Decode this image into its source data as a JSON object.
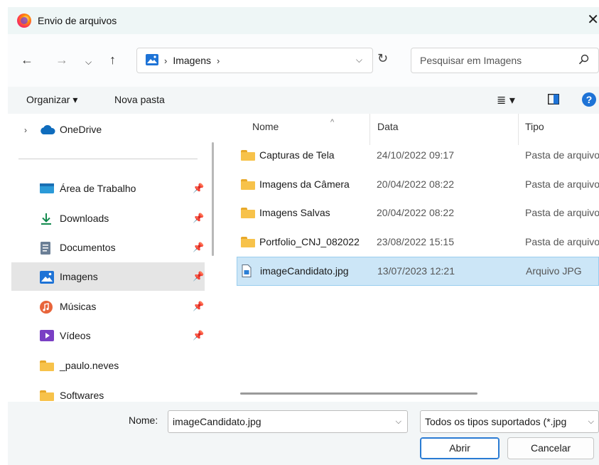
{
  "window": {
    "title": "Envio de arquivos",
    "close_label": "✕"
  },
  "nav": {
    "breadcrumb": [
      "Imagens"
    ],
    "search_placeholder": "Pesquisar em Imagens"
  },
  "toolbar": {
    "organize": "Organizar ▾",
    "new_folder": "Nova pasta"
  },
  "sidebar": {
    "onedrive": "OneDrive",
    "items": [
      {
        "label": "Área de Trabalho",
        "icon": "desktop-icon",
        "pinned": true
      },
      {
        "label": "Downloads",
        "icon": "download-icon",
        "pinned": true
      },
      {
        "label": "Documentos",
        "icon": "document-icon",
        "pinned": true
      },
      {
        "label": "Imagens",
        "icon": "pictures-icon",
        "pinned": true,
        "selected": true
      },
      {
        "label": "Músicas",
        "icon": "music-icon",
        "pinned": true
      },
      {
        "label": "Vídeos",
        "icon": "video-icon",
        "pinned": true
      },
      {
        "label": "_paulo.neves",
        "icon": "folder-icon",
        "pinned": false
      },
      {
        "label": "Softwares",
        "icon": "folder-icon",
        "pinned": false
      }
    ]
  },
  "list": {
    "columns": {
      "name": "Nome",
      "date": "Data",
      "type": "Tipo"
    },
    "rows": [
      {
        "name": "Capturas de Tela",
        "date": "24/10/2022 09:17",
        "type": "Pasta de arquivos",
        "kind": "folder"
      },
      {
        "name": "Imagens da Câmera",
        "date": "20/04/2022 08:22",
        "type": "Pasta de arquivos",
        "kind": "folder"
      },
      {
        "name": "Imagens Salvas",
        "date": "20/04/2022 08:22",
        "type": "Pasta de arquivos",
        "kind": "folder"
      },
      {
        "name": "Portfolio_CNJ_082022",
        "date": "23/08/2022 15:15",
        "type": "Pasta de arquivos",
        "kind": "folder"
      },
      {
        "name": "imageCandidato.jpg",
        "date": "13/07/2023 12:21",
        "type": "Arquivo JPG",
        "kind": "file",
        "selected": true
      }
    ]
  },
  "footer": {
    "name_label": "Nome:",
    "name_value": "imageCandidato.jpg",
    "filter_value": "Todos os tipos suportados (*.jpg",
    "open": "Abrir",
    "cancel": "Cancelar"
  },
  "colors": {
    "accent": "#1e73d6",
    "selection": "#cce6f7",
    "folder": "#f7c24a"
  }
}
